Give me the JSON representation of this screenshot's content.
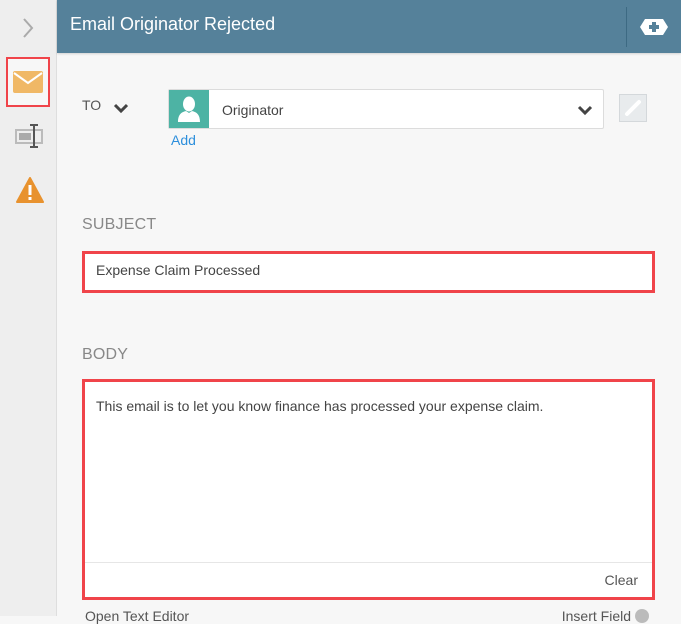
{
  "rail": {
    "items": [
      {
        "id": "expand",
        "icon": "chevron-right-icon"
      },
      {
        "id": "email",
        "icon": "envelope-icon",
        "active": true
      },
      {
        "id": "field",
        "icon": "text-field-icon"
      },
      {
        "id": "warning",
        "icon": "warning-icon"
      }
    ]
  },
  "header": {
    "title": "Email Originator Rejected",
    "add_icon": "add-icon"
  },
  "to": {
    "label": "TO",
    "recipient": "Originator",
    "add_label": "Add"
  },
  "subject": {
    "label": "SUBJECT",
    "value": "Expense Claim Processed"
  },
  "body": {
    "label": "BODY",
    "value": "This email is to let you know finance has processed your expense claim.",
    "clear_label": "Clear"
  },
  "footer": {
    "left_link": "Open Text Editor",
    "right_link": "Insert Field"
  },
  "colors": {
    "header": "#55819a",
    "highlight": "#f0444a",
    "accent_orange": "#f0a94d",
    "avatar": "#4db3a4",
    "link": "#2d8fdc"
  }
}
